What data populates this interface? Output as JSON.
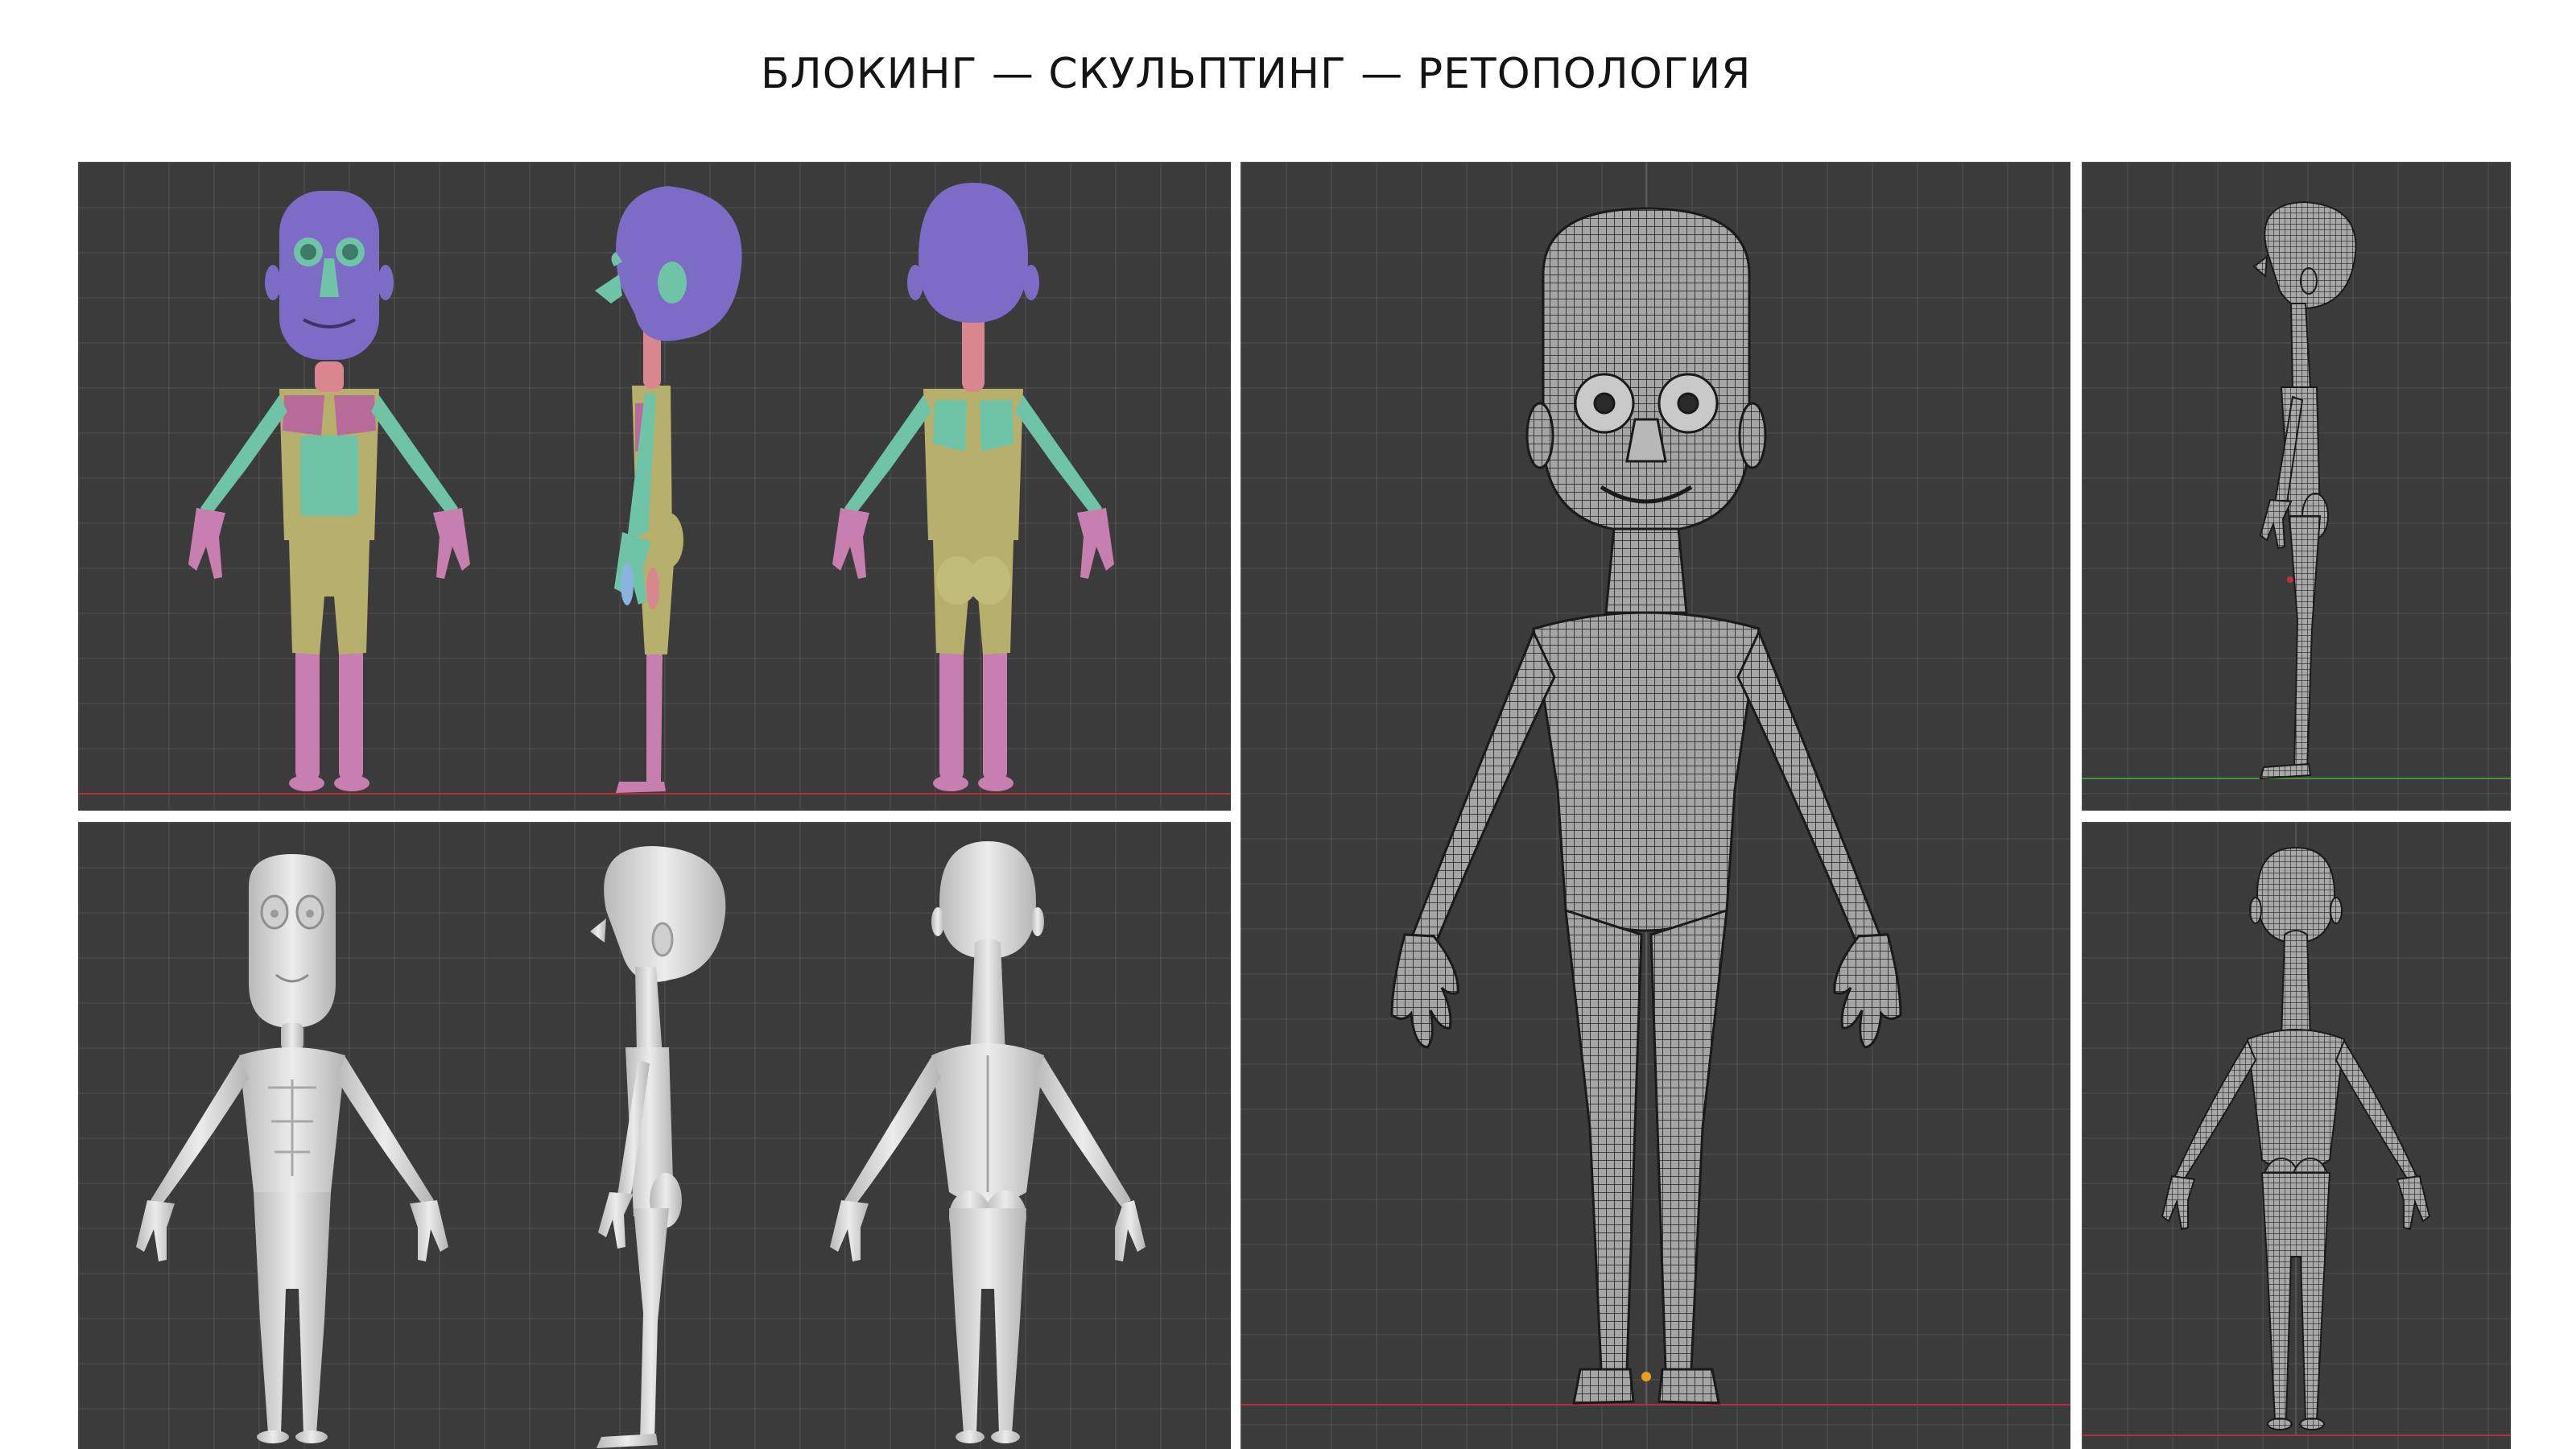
{
  "header": {
    "title": "БЛОКИНГ — СКУЛЬПТИНГ — РЕТОПОЛОГИЯ"
  },
  "panels": [
    {
      "name": "blocking-views",
      "views": [
        "front",
        "side",
        "back"
      ]
    },
    {
      "name": "sculpting-views",
      "views": [
        "front",
        "side",
        "back"
      ]
    },
    {
      "name": "retopology-front",
      "views": [
        "front"
      ]
    },
    {
      "name": "retopology-side",
      "views": [
        "side"
      ]
    },
    {
      "name": "retopology-back",
      "views": [
        "back"
      ]
    }
  ],
  "colors": {
    "viewport_bg": "#3b3b3b",
    "grid": "#4a4a4a",
    "blocking_head": "#7d6cc6",
    "blocking_torso": "#b6b06c",
    "blocking_limbs": "#6fc3a6",
    "blocking_pink": "#c76e9a",
    "sculpt_clay": "#dcdcdc",
    "wire": "#1f1f1f",
    "axis_red": "#b03040",
    "axis_green": "#4f8f3a"
  }
}
